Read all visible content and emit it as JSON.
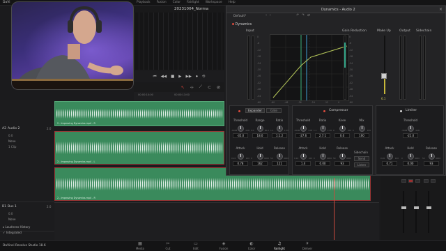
{
  "app": {
    "logo": "DaVi",
    "project_title": "20231004_Norma",
    "menus": [
      "Playback",
      "Fusion",
      "Color",
      "Fairlight",
      "Workspace",
      "Help"
    ],
    "brand": "DaVinci Resolve Studio 18.6"
  },
  "transport": [
    "⏮",
    "◀◀",
    "■",
    "▶",
    "▶▶",
    "⏺",
    "⟲"
  ],
  "ruler_ticks": [
    "00:00:10:00",
    "00:00:13:00"
  ],
  "dynamics": {
    "title": "Dynamics - Audio 2",
    "preset": "Default*",
    "section": "Dynamics",
    "columns": [
      "Input",
      "Gain Reduction",
      "Make Up",
      "Output",
      "Sidechain"
    ],
    "graph_axis": [
      "-60",
      "-48",
      "-36",
      "-24",
      "-12",
      "0"
    ],
    "meter_scale": [
      "0",
      "-6",
      "-12",
      "-18",
      "-24",
      "-30",
      "-36",
      "-42",
      "-48",
      "-54",
      "-60"
    ],
    "makeup_value": "6.1",
    "expander": {
      "tab_expander": "Expander",
      "tab_gate": "Gate",
      "knobs": [
        {
          "label": "Threshold",
          "min": "-60dB",
          "max": "0dB",
          "value": "-35.0"
        },
        {
          "label": "Range",
          "min": "0.0",
          "max": "60.0",
          "value": "18.0"
        },
        {
          "label": "Ratio",
          "min": "1.1",
          "max": "1:10",
          "value": "1:1.2"
        },
        {
          "label": "Attack",
          "min": "0.10",
          "max": "100",
          "value": "0.78"
        },
        {
          "label": "Hold",
          "min": "0",
          "max": "4000",
          "value": "162"
        },
        {
          "label": "Release",
          "min": "50",
          "max": "4000",
          "value": "121"
        }
      ]
    },
    "compressor": {
      "title": "Compressor",
      "knobs": [
        {
          "label": "Threshold",
          "min": "-60dB",
          "max": "0dB",
          "value": "-27.6"
        },
        {
          "label": "Ratio",
          "min": "1.1",
          "max": "1:20",
          "value": "2.7:1"
        },
        {
          "label": "Knee",
          "min": "0",
          "max": "100",
          "value": "0.0"
        },
        {
          "label": "Mix",
          "min": "0",
          "max": "100",
          "value": "100"
        },
        {
          "label": "Attack",
          "min": "0.10",
          "max": "100",
          "value": "1.4"
        },
        {
          "label": "Hold",
          "min": "0",
          "max": "4000",
          "value": "0.00"
        },
        {
          "label": "Release",
          "min": "50",
          "max": "4000",
          "value": "93"
        }
      ],
      "sidechain_label": "Sidechain",
      "send_label": "Send",
      "listen_label": "Listen"
    },
    "limiter": {
      "title": "Limiter",
      "knobs": [
        {
          "label": "Threshold",
          "min": "-30dB",
          "max": "0dB",
          "value": "-21.0"
        },
        {
          "label": "Attack",
          "min": "0.00",
          "max": "100",
          "value": "0.71"
        },
        {
          "label": "Hold",
          "min": "0",
          "max": "4000",
          "value": "0.00"
        },
        {
          "label": "Release",
          "min": "50",
          "max": "4000",
          "value": "93"
        }
      ]
    }
  },
  "tracks": [
    {
      "id": "A2",
      "name": "Audio 2",
      "num": "2.0",
      "val": "0.0",
      "sel": "None",
      "clip": "1 Clip"
    },
    {
      "id": "B1",
      "name": "Bus 1",
      "num": "2.0",
      "val": "0.0",
      "sel": "None",
      "clip": ""
    }
  ],
  "clips": [
    {
      "label": "2 - Improving Dynamics.mp4 - R"
    },
    {
      "label": "2 - Improving Dynamics.mp4 - L"
    },
    {
      "label": "2 - Improving Dynamics.mp4 - R"
    }
  ],
  "history": [
    "Loudness History",
    "Integrated"
  ],
  "pages": [
    {
      "icon": "▦",
      "label": "Media"
    },
    {
      "icon": "✂",
      "label": "Cut"
    },
    {
      "icon": "▭",
      "label": "Edit"
    },
    {
      "icon": "◈",
      "label": "Fusion"
    },
    {
      "icon": "◐",
      "label": "Color"
    },
    {
      "icon": "♫",
      "label": "Fairlight"
    },
    {
      "icon": "✈",
      "label": "Deliver"
    }
  ],
  "colors": {
    "accent_red": "#d94a3c",
    "clip_green": "#3a8a5c",
    "graph_line": "#b6c85a",
    "graph_blue": "#3fa0d8",
    "graph_green": "#3bb07a"
  }
}
